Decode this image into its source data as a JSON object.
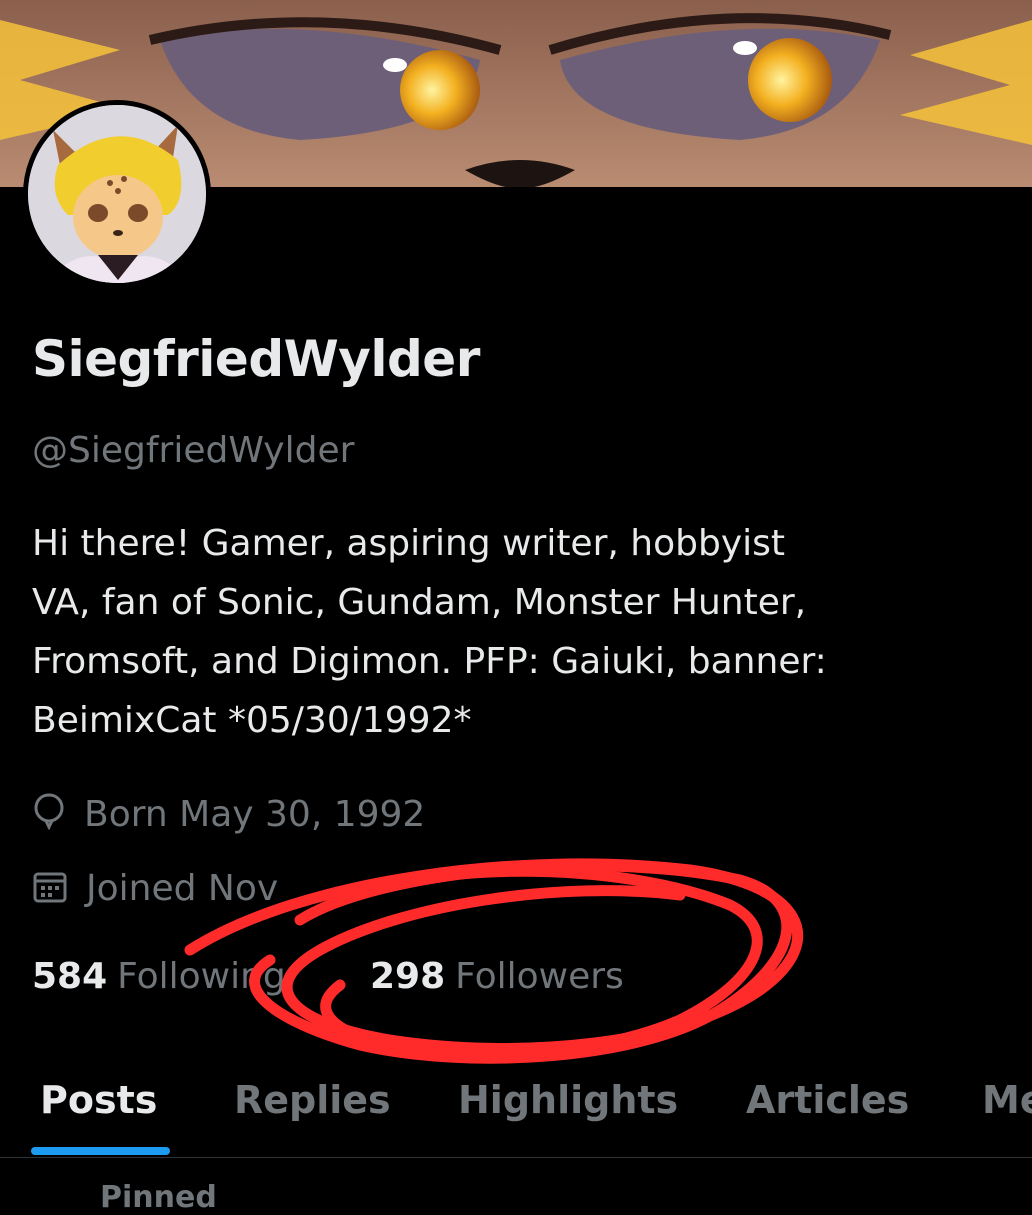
{
  "profile": {
    "display_name": "SiegfriedWylder",
    "handle": "@SiegfriedWylder",
    "bio_lines": [
      "Hi there!  Gamer, aspiring writer, hobbyist",
      "VA, fan of Sonic, Gundam, Monster Hunter,",
      "Fromsoft, and Digimon. PFP: Gaiuki, banner:",
      "BeimixCat  *05/30/1992*"
    ],
    "born": "Born May 30, 1992",
    "joined": "Joined Nov",
    "following_count": "584",
    "following_label": "Following",
    "followers_count": "298",
    "followers_label": "Followers"
  },
  "tabs": [
    {
      "label": "Posts",
      "active": true
    },
    {
      "label": "Replies",
      "active": false
    },
    {
      "label": "Highlights",
      "active": false
    },
    {
      "label": "Articles",
      "active": false
    },
    {
      "label": "Me",
      "active": false
    }
  ],
  "pinned_label": "Pinned",
  "colors": {
    "background": "#000000",
    "primary_text": "#e7e9ea",
    "secondary_text": "#71767b",
    "accent": "#1d9bf0",
    "annotation": "#ff2b2b"
  },
  "icons": {
    "born": "balloon-icon",
    "joined": "calendar-icon"
  }
}
